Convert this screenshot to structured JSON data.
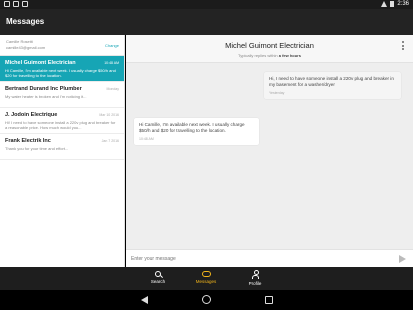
{
  "status_bar": {
    "time": "2:36"
  },
  "app_bar": {
    "title": "Messages"
  },
  "account": {
    "name": "Camille Rosetti",
    "email": "camille43@gmail.com",
    "change_label": "Change"
  },
  "conversations": [
    {
      "name": "Michel Guimont Electrician",
      "time": "10:48 AM",
      "snippet": "Hi Camille, I'm available next week. I usually charge $50/h and $20 for travelling to the location.",
      "active": true
    },
    {
      "name": "Bertrand Durand Inc Plumber",
      "time": "Monday",
      "snippet": "My water heater is broken and I'm noticing it..."
    },
    {
      "name": "J. Jodoin Electrique",
      "time": "Mar 10 2016",
      "snippet": "Hi! I need to have someone install a 220v plug and breaker for a reasonable price. How much would you..."
    },
    {
      "name": "Frank Electrik Inc",
      "time": "Jan 7 2016",
      "snippet": "Thank you for your time and effort..."
    }
  ],
  "chat": {
    "title": "Michel Guimont Electrician",
    "subtitle_prefix": "Typically replies within",
    "subtitle_bold": "a few hours",
    "messages": [
      {
        "direction": "out",
        "text": "Hi, I need to have someone install a 220v plug and breaker in my basement for a washer/dryer",
        "time": "Yesterday"
      },
      {
        "direction": "in",
        "text": "Hi Camille, I'm available next week. I usually charge $50/h and $20 for travelling to the location.",
        "time": "10:48 AM"
      }
    ],
    "composer_placeholder": "Enter your message"
  },
  "bottom_nav": {
    "items": [
      {
        "label": "Search",
        "icon": "search-icon"
      },
      {
        "label": "Messages",
        "icon": "messages-icon",
        "active": true
      },
      {
        "label": "Profile",
        "icon": "profile-icon"
      }
    ]
  },
  "colors": {
    "accent": "#16a5b5",
    "active_nav": "#f2b51b",
    "app_bar": "#232323"
  }
}
